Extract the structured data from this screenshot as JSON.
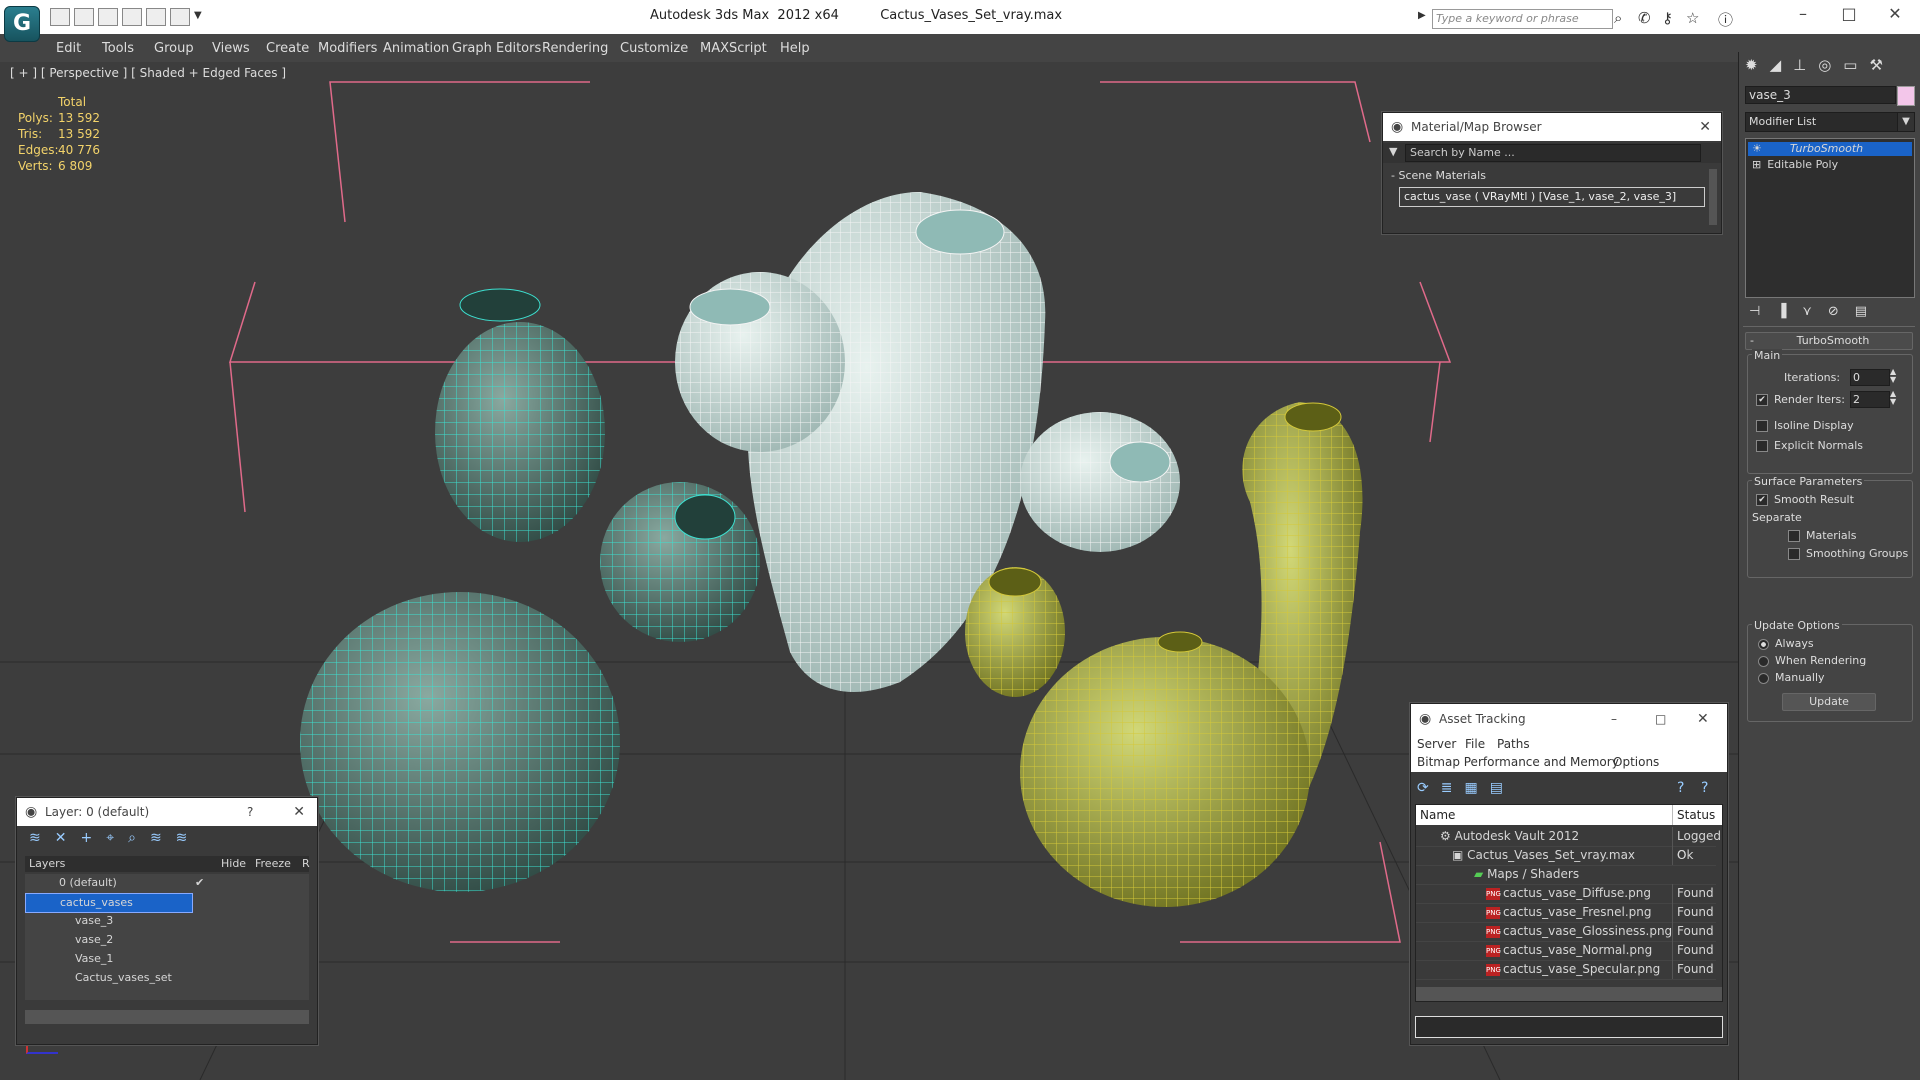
{
  "titlebar": {
    "app_title": "Autodesk 3ds Max  2012 x64",
    "file_name": "Cactus_Vases_Set_vray.max",
    "search_placeholder": "Type a keyword or phrase"
  },
  "menus": [
    "Edit",
    "Tools",
    "Group",
    "Views",
    "Create",
    "Modifiers",
    "Animation",
    "Graph Editors",
    "Rendering",
    "Customize",
    "MAXScript",
    "Help"
  ],
  "viewport": {
    "label": "[ + ] [ Perspective ] [ Shaded + Edged Faces ]",
    "stats_header": "Total",
    "stats": [
      {
        "label": "Polys:",
        "value": "13 592"
      },
      {
        "label": "Tris:",
        "value": "13 592"
      },
      {
        "label": "Edges:",
        "value": "40 776"
      },
      {
        "label": "Verts:",
        "value": "6 809"
      }
    ]
  },
  "material_browser": {
    "title": "Material/Map Browser",
    "search_placeholder": "Search by Name ...",
    "section": "Scene Materials",
    "item": "cactus_vase  ( VRayMtl ) [Vase_1, vase_2, vase_3]"
  },
  "layer_panel": {
    "title": "Layer: 0 (default)",
    "help": "?",
    "columns": {
      "layers": "Layers",
      "hide": "Hide",
      "freeze": "Freeze",
      "r": "R"
    },
    "rows": [
      {
        "name": "0 (default)",
        "indent": 1
      },
      {
        "name": "cactus_vases",
        "indent": 1
      },
      {
        "name": "vase_3",
        "indent": 2
      },
      {
        "name": "vase_2",
        "indent": 2
      },
      {
        "name": "Vase_1",
        "indent": 2
      },
      {
        "name": "Cactus_vases_set",
        "indent": 2
      }
    ]
  },
  "asset_tracking": {
    "title": "Asset Tracking",
    "menu1": [
      "Server",
      "File",
      "Paths"
    ],
    "menu2": [
      "Bitmap Performance and Memory",
      "Options"
    ],
    "columns": {
      "name": "Name",
      "status": "Status"
    },
    "rows": [
      {
        "name": "Autodesk Vault 2012",
        "status": "Logged O",
        "indent": 1
      },
      {
        "name": "Cactus_Vases_Set_vray.max",
        "status": "Ok",
        "indent": 2
      },
      {
        "name": "Maps / Shaders",
        "status": "",
        "indent": 3
      },
      {
        "name": "cactus_vase_Diffuse.png",
        "status": "Found",
        "indent": 4
      },
      {
        "name": "cactus_vase_Fresnel.png",
        "status": "Found",
        "indent": 4
      },
      {
        "name": "cactus_vase_Glossiness.png",
        "status": "Found",
        "indent": 4
      },
      {
        "name": "cactus_vase_Normal.png",
        "status": "Found",
        "indent": 4
      },
      {
        "name": "cactus_vase_Specular.png",
        "status": "Found",
        "indent": 4
      }
    ]
  },
  "command_panel": {
    "object_name": "vase_3",
    "modifier_list": "Modifier List",
    "stack": [
      "TurboSmooth",
      "Editable Poly"
    ],
    "rollout_title": "TurboSmooth",
    "main_label": "Main",
    "iterations_label": "Iterations:",
    "iterations_value": "0",
    "render_iters_label": "Render Iters:",
    "render_iters_value": "2",
    "isoline_label": "Isoline Display",
    "explicit_normals_label": "Explicit Normals",
    "surface_params_label": "Surface Parameters",
    "smooth_result_label": "Smooth Result",
    "separate_label": "Separate",
    "materials_label": "Materials",
    "smoothing_groups_label": "Smoothing Groups",
    "update_options_label": "Update Options",
    "always_label": "Always",
    "when_rendering_label": "When Rendering",
    "manually_label": "Manually",
    "update_button": "Update"
  },
  "colors": {
    "accent_select": "#1a63c8",
    "wire_teal": "#3de0d0",
    "wire_white": "#f4f4f4",
    "wire_yellow": "#d4c83a",
    "bbox": "#e06a8a"
  }
}
